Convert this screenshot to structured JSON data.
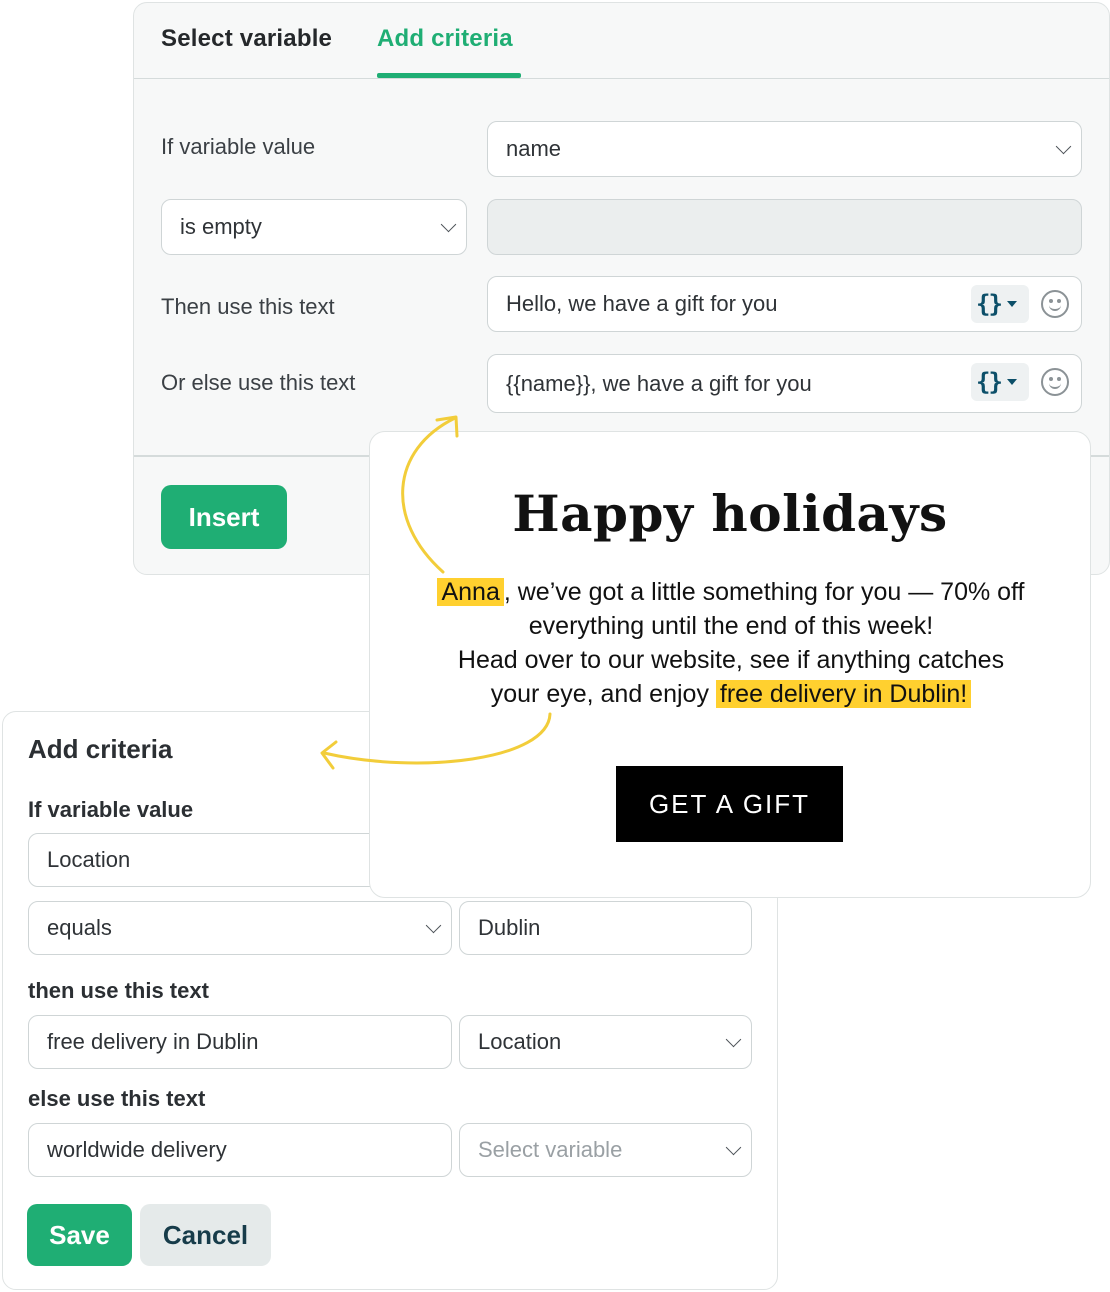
{
  "top_panel": {
    "tabs": [
      {
        "label": "Select variable",
        "active": false
      },
      {
        "label": "Add criteria",
        "active": true
      }
    ],
    "if_variable_label": "If variable value",
    "variable_select": "name",
    "operator_select": "is empty",
    "operator_value": "",
    "then_label": "Then use this text",
    "then_text": "Hello, we have a gift for you",
    "else_label": "Or else use this text",
    "else_text": "{{name}}, we have a gift for you",
    "variable_button_glyph": "{}",
    "insert_label": "Insert"
  },
  "email_preview": {
    "title": "Happy holidays",
    "name_highlight": "Anna",
    "line1_rest": ", we’ve got a little something for you — 70% off",
    "line2": "everything until the end of this week!",
    "line3": "Head over to our website, see if anything catches",
    "line4_start": "your eye, and enjoy ",
    "delivery_highlight": "free delivery in Dublin!",
    "button_label": "GET A GIFT",
    "highlight_color": "#ffd02f"
  },
  "bottom_panel": {
    "title": "Add criteria",
    "if_variable_label": "If variable value",
    "variable_select": "Location",
    "operator_select": "equals",
    "operator_value": "Dublin",
    "then_label": "then use this text",
    "then_text": "free delivery in Dublin",
    "then_variable_select": "Location",
    "else_label": "else use this text",
    "else_text": "worldwide delivery",
    "else_variable_placeholder": "Select variable",
    "save_label": "Save",
    "cancel_label": "Cancel"
  },
  "colors": {
    "accent": "#1fae74",
    "arrow": "#f2cd3a",
    "braces": "#0c4f69"
  }
}
